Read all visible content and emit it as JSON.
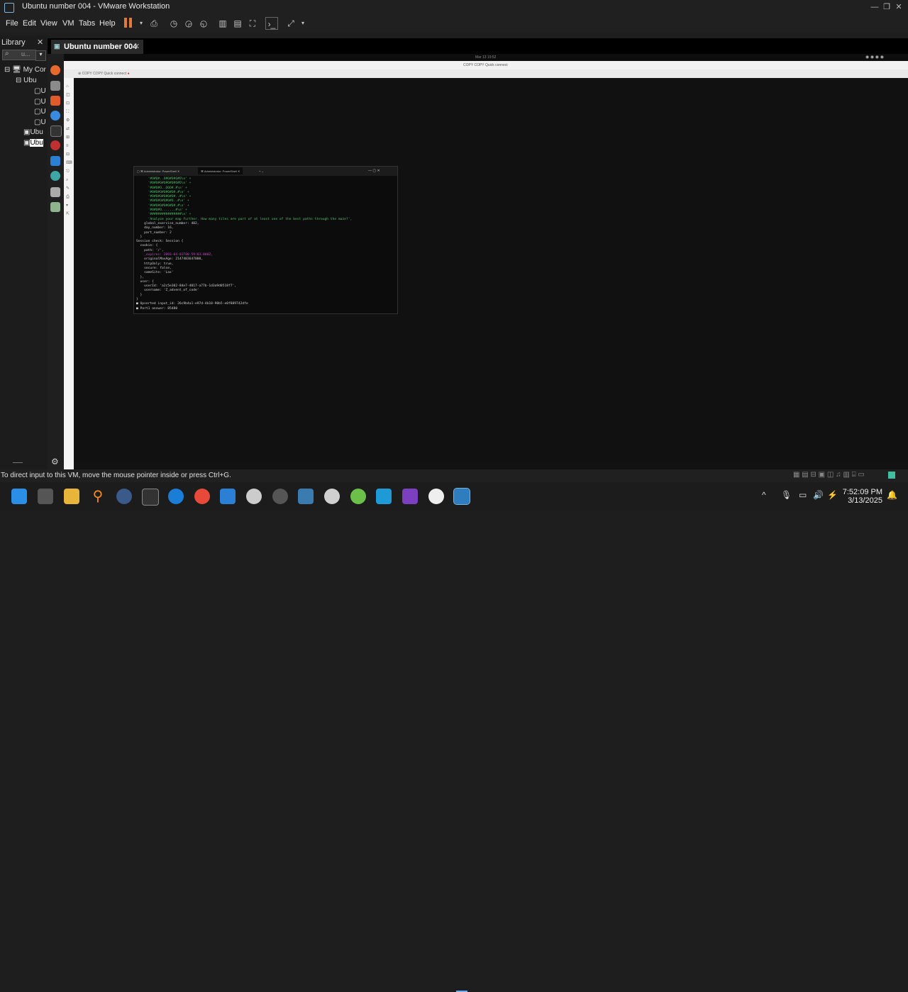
{
  "window": {
    "title": "Ubuntu number 004 - VMware Workstation",
    "min": "—",
    "max": "❐",
    "close": "✕"
  },
  "menu": [
    "File",
    "Edit",
    "View",
    "VM",
    "Tabs",
    "Help"
  ],
  "library": {
    "title": "Library",
    "close": "✕",
    "search_placeholder": "u...",
    "tree": [
      "My Cor",
      "Ubu",
      "U",
      "U",
      "U",
      "U",
      "Ubu",
      "Ubu"
    ]
  },
  "vm_tab": {
    "label": "Ubuntu number 004",
    "close": "✕"
  },
  "guest": {
    "topbar_time": "Mar 13 19:52",
    "rdp_title": "COPY COPY Quick connect",
    "rdp_tab": "COPY COPY Quick connect",
    "terminal": {
      "tabs": [
        "Administrator: PowerShell",
        "Administrator: PowerShell"
      ],
      "lines": [
        {
          "t": "      '#O#O#..O#O#O#O#O\\n' +",
          "c": "g"
        },
        {
          "t": "      '#O#O#O#O#O#O#O#O\\n' +",
          "c": "g"
        },
        {
          "t": "      '#O#O#O..OOO#.#\\n' +",
          "c": "g"
        },
        {
          "t": "      '#O#O#O#O#O#O#.#\\n' +",
          "c": "g"
        },
        {
          "t": "      '#O#O#O#O#O#O#..#\\n' +",
          "c": "g"
        },
        {
          "t": "      '#O#O#O#O#O#O..#\\n' +",
          "c": "g"
        },
        {
          "t": "      '#O#O#O#O#O#O#.#\\n' +",
          "c": "g"
        },
        {
          "t": "      '#O#O#O.......#\\n' +",
          "c": "g"
        },
        {
          "t": "      '################\\n' +",
          "c": "g"
        },
        {
          "t": "      'Analyze your map further. How many tiles are part of at least one of the best paths through the maze?',",
          "c": "g"
        },
        {
          "t": "    global_exercise_number: 402,",
          "c": ""
        },
        {
          "t": "    day_number: 16,",
          "c": ""
        },
        {
          "t": "    part_number: 2",
          "c": ""
        },
        {
          "t": "  }",
          "c": ""
        },
        {
          "t": "Session check: Session {",
          "c": ""
        },
        {
          "t": "  cookie: {",
          "c": ""
        },
        {
          "t": "    path: '/',",
          "c": ""
        },
        {
          "t": "    _expires: 2093-04-01T00:59:03.000Z,",
          "c": "m"
        },
        {
          "t": "    originalMaxAge: 2147483647000,",
          "c": ""
        },
        {
          "t": "    httpOnly: true,",
          "c": ""
        },
        {
          "t": "    secure: false,",
          "c": ""
        },
        {
          "t": "    sameSite: 'Lax'",
          "c": ""
        },
        {
          "t": "  },",
          "c": ""
        },
        {
          "t": "  user: {",
          "c": ""
        },
        {
          "t": "    userId: 'a2c5e302-84e7-4017-a77b-1d3a9d0518f7',",
          "c": ""
        },
        {
          "t": "    username: 'Z_advent_of_code'",
          "c": ""
        },
        {
          "t": "  }",
          "c": ""
        },
        {
          "t": "}",
          "c": ""
        },
        {
          "t": "■ Upserted input_id: 26c9b4a1-e97d-4b10-90b5-e0f889742dfe",
          "c": ""
        },
        {
          "t": "■ Part1 answer: 85480",
          "c": ""
        }
      ]
    }
  },
  "status_message": "To direct input to this VM, move the mouse pointer inside or press Ctrl+G.",
  "taskbar": {
    "time": "7:52:09 PM",
    "date": "3/13/2025"
  },
  "colors": {
    "accent": "#e07a3a",
    "terminal_green": "#4fc26a",
    "vmware_blue": "#7fb3d9"
  }
}
